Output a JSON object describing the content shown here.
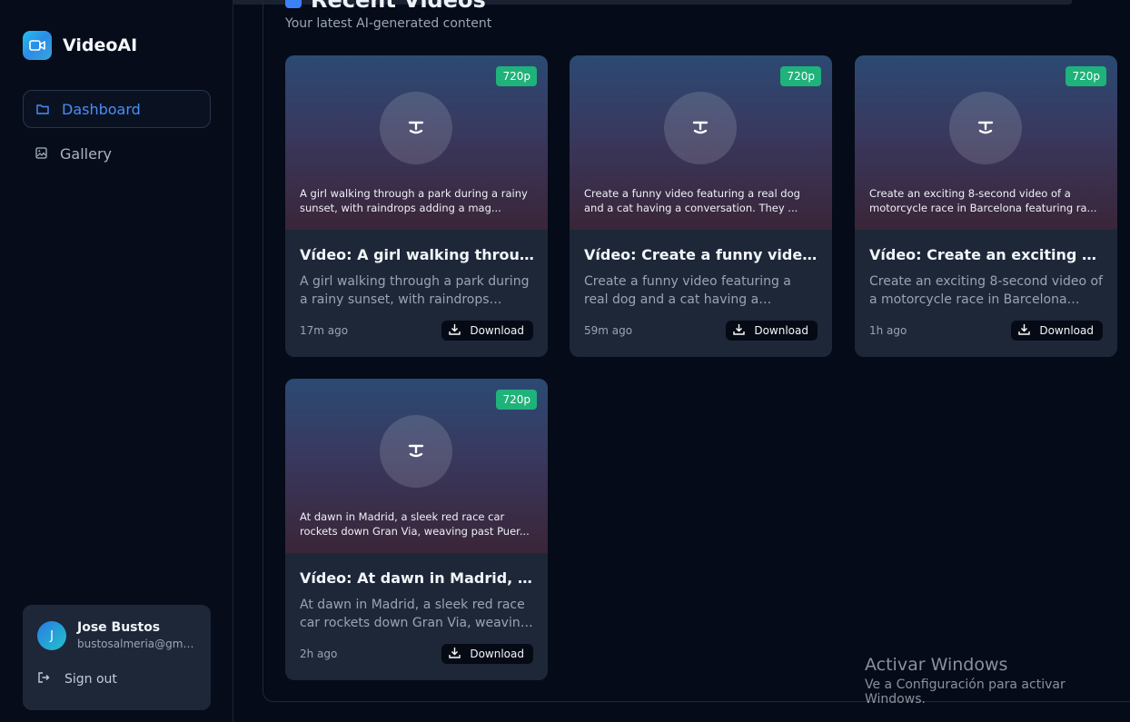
{
  "brand": {
    "name": "VideoAI",
    "icon": "video-camera-icon"
  },
  "sidebar": {
    "items": [
      {
        "label": "Dashboard",
        "icon": "folder-icon",
        "active": true
      },
      {
        "label": "Gallery",
        "icon": "image-icon",
        "active": false
      }
    ]
  },
  "user": {
    "initial": "J",
    "name": "Jose Bustos",
    "email": "bustosalmeria@gmail...",
    "signout_label": "Sign out"
  },
  "main": {
    "title": "Recent Videos",
    "subtitle": "Your latest AI-generated content",
    "videos": [
      {
        "resolution": "720p",
        "thumb_text": "A girl walking through a park during a rainy sunset, with raindrops adding a mag...",
        "title": "Vídeo: A girl walking through a...",
        "desc": "A girl walking through a park during a rainy sunset, with raindrops adding a...",
        "time": "17m ago",
        "download_label": "Download"
      },
      {
        "resolution": "720p",
        "thumb_text": "Create a funny video featuring a real dog and a cat having a conversation. They ...",
        "title": "Vídeo: Create a funny video...",
        "desc": "Create a funny video featuring a real dog and a cat having a conversation....",
        "time": "59m ago",
        "download_label": "Download"
      },
      {
        "resolution": "720p",
        "thumb_text": "Create an exciting 8-second video of a motorcycle race in Barcelona featuring ra...",
        "title": "Vídeo: Create an exciting 8-...",
        "desc": "Create an exciting 8-second video of a motorcycle race in Barcelona featurin...",
        "time": "1h ago",
        "download_label": "Download"
      },
      {
        "resolution": "720p",
        "thumb_text": "At dawn in Madrid, a sleek red race car rockets down Gran Via, weaving past Puer...",
        "title": "Vídeo: At dawn in Madrid, a slee...",
        "desc": "At dawn in Madrid, a sleek red race car rockets down Gran Via, weaving past...",
        "time": "2h ago",
        "download_label": "Download"
      }
    ]
  },
  "watermark": {
    "line1": "Activar Windows",
    "line2": "Ve a Configuración para activar Windows."
  }
}
